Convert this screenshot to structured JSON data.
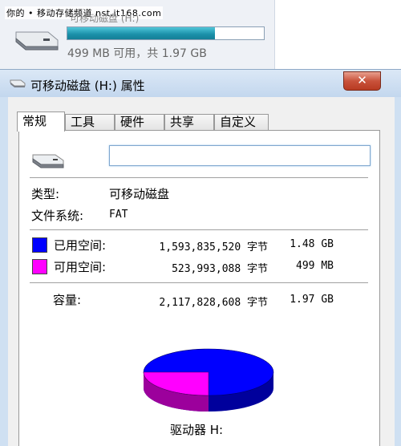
{
  "watermark": "你的 • 移动存储频道 nst.it168.com",
  "explorer": {
    "drive_name": "可移动磁盘 (H:)",
    "drive_free_text": "499 MB 可用，共 1.97 GB",
    "usage_fraction": 0.753
  },
  "dialog": {
    "title": "可移动磁盘 (H:) 属性",
    "close_label": "✕",
    "tabs": [
      "常规",
      "工具",
      "硬件",
      "共享",
      "自定义"
    ],
    "name_value": "",
    "type_label": "类型:",
    "type_value": "可移动磁盘",
    "fs_label": "文件系统:",
    "fs_value": "FAT",
    "used_label": "已用空间:",
    "used_bytes": "1,593,835,520 字节",
    "used_human": "1.48 GB",
    "free_label": "可用空间:",
    "free_bytes": "523,993,088 字节",
    "free_human": "499 MB",
    "capacity_label": "容量:",
    "capacity_bytes": "2,117,828,608 字节",
    "capacity_human": "1.97 GB",
    "drive_caption": "驱动器 H:"
  },
  "colors": {
    "used": "#0000ff",
    "free": "#ff00ff",
    "used_side": "#00009c",
    "free_side": "#9c009c"
  },
  "icons": {
    "drive": "removable-drive-icon",
    "close": "close-icon"
  }
}
